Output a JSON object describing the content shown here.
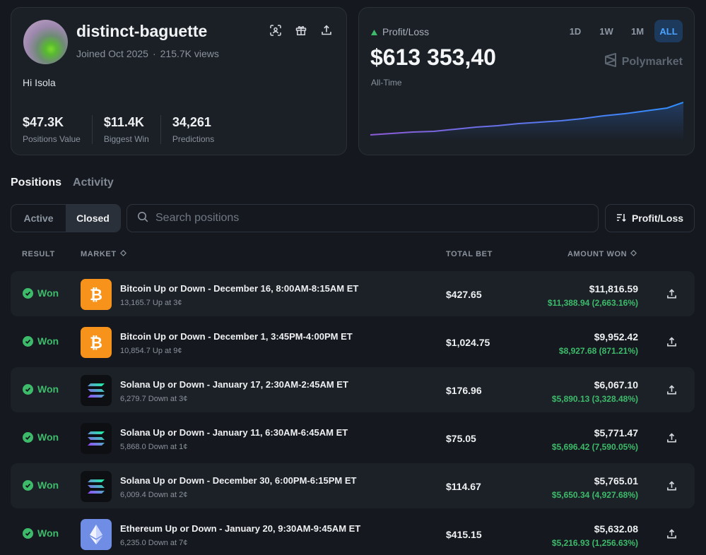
{
  "profile": {
    "username": "distinct-baguette",
    "joined": "Joined Oct 2025",
    "views": "215.7K views",
    "greeting": "Hi Isola",
    "stats": [
      {
        "value": "$47.3K",
        "label": "Positions Value"
      },
      {
        "value": "$11.4K",
        "label": "Biggest Win"
      },
      {
        "value": "34,261",
        "label": "Predictions"
      }
    ],
    "icons": [
      "scan-icon",
      "gift-icon",
      "share-icon"
    ]
  },
  "pnl": {
    "label": "Profit/Loss",
    "value": "$613 353,40",
    "period_label": "All-Time",
    "timeframes": [
      "1D",
      "1W",
      "1M",
      "ALL"
    ],
    "active_timeframe": "ALL",
    "brand": "Polymarket",
    "colors": {
      "up": "#3dbb6a",
      "line_start": "#8f5bd8",
      "line_end": "#2e8fff"
    }
  },
  "tabs": {
    "positions": "Positions",
    "activity": "Activity",
    "active": "Positions"
  },
  "filters": {
    "active_label": "Active",
    "closed_label": "Closed",
    "selected": "Closed"
  },
  "search": {
    "placeholder": "Search positions"
  },
  "sort": {
    "label": "Profit/Loss"
  },
  "table": {
    "headers": {
      "result": "RESULT",
      "market": "MARKET",
      "total_bet": "TOTAL BET",
      "amount_won": "AMOUNT WON"
    },
    "rows": [
      {
        "result": "Won",
        "asset": "bitcoin",
        "title": "Bitcoin Up or Down - December 16, 8:00AM-8:15AM ET",
        "subtitle": "13,165.7 Up at 3¢",
        "total_bet": "$427.65",
        "amount_won": "$11,816.59",
        "gain": "$11,388.94 (2,663.16%)"
      },
      {
        "result": "Won",
        "asset": "bitcoin",
        "title": "Bitcoin Up or Down - December 1, 3:45PM-4:00PM ET",
        "subtitle": "10,854.7 Up at 9¢",
        "total_bet": "$1,024.75",
        "amount_won": "$9,952.42",
        "gain": "$8,927.68 (871.21%)"
      },
      {
        "result": "Won",
        "asset": "solana",
        "title": "Solana Up or Down - January 17, 2:30AM-2:45AM ET",
        "subtitle": "6,279.7 Down at 3¢",
        "total_bet": "$176.96",
        "amount_won": "$6,067.10",
        "gain": "$5,890.13 (3,328.48%)"
      },
      {
        "result": "Won",
        "asset": "solana",
        "title": "Solana Up or Down - January 11, 6:30AM-6:45AM ET",
        "subtitle": "5,868.0 Down at 1¢",
        "total_bet": "$75.05",
        "amount_won": "$5,771.47",
        "gain": "$5,696.42 (7,590.05%)"
      },
      {
        "result": "Won",
        "asset": "solana",
        "title": "Solana Up or Down - December 30, 6:00PM-6:15PM ET",
        "subtitle": "6,009.4 Down at 2¢",
        "total_bet": "$114.67",
        "amount_won": "$5,765.01",
        "gain": "$5,650.34 (4,927.68%)"
      },
      {
        "result": "Won",
        "asset": "ethereum",
        "title": "Ethereum Up or Down - January 20, 9:30AM-9:45AM ET",
        "subtitle": "6,235.0 Down at 7¢",
        "total_bet": "$415.15",
        "amount_won": "$5,632.08",
        "gain": "$5,216.93 (1,256.63%)"
      }
    ]
  }
}
